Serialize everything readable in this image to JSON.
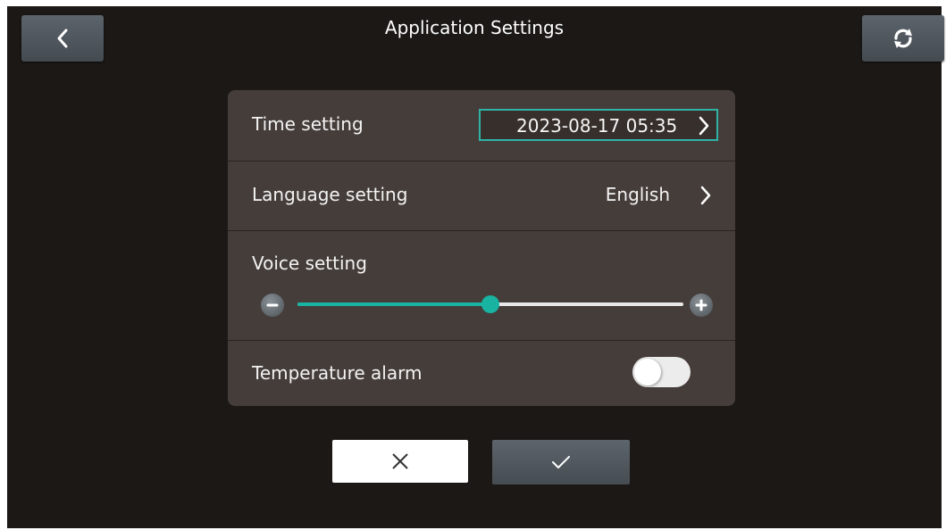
{
  "header": {
    "title": "Application Settings",
    "back_icon": "chevron-left-icon",
    "refresh_icon": "refresh-icon"
  },
  "settings": {
    "time": {
      "label": "Time setting",
      "value": "2023-08-17 05:35"
    },
    "language": {
      "label": "Language setting",
      "value": "English"
    },
    "voice": {
      "label": "Voice setting",
      "level_percent": 50
    },
    "temperature_alarm": {
      "label": "Temperature alarm",
      "enabled": false
    }
  },
  "footer": {
    "cancel_icon": "close-icon",
    "confirm_icon": "check-icon"
  },
  "colors": {
    "accent": "#19b3a2",
    "panel": "#453d3a",
    "background": "#1b1816"
  }
}
